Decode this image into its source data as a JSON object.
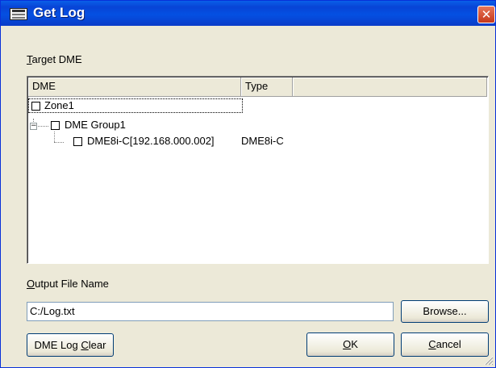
{
  "window": {
    "title": "Get Log",
    "icon": "dme-app-icon",
    "close_glyph": "✕"
  },
  "target_label": {
    "underline": "T",
    "rest": "arget DME"
  },
  "tree": {
    "columns": [
      "DME",
      "Type"
    ],
    "rows": [
      {
        "name": "Zone1",
        "type": ""
      },
      {
        "name": "DME Group1",
        "type": "",
        "expander": "−"
      },
      {
        "name": "DME8i-C[192.168.000.002]",
        "type": "DME8i-C"
      }
    ]
  },
  "output_label": {
    "underline": "O",
    "rest": "utput File Name"
  },
  "output_field": {
    "value": "C:/Log.txt"
  },
  "buttons": {
    "browse": "Browse...",
    "log_clear": {
      "prefix": "DME Log ",
      "underline": "C",
      "rest": "lear"
    },
    "ok": {
      "underline": "O",
      "rest": "K"
    },
    "cancel": {
      "underline": "C",
      "rest": "ancel"
    }
  },
  "colors": {
    "title_bar": "#0a5fe8",
    "dialog_bg": "#ece9d8",
    "close_btn": "#c5371a"
  }
}
